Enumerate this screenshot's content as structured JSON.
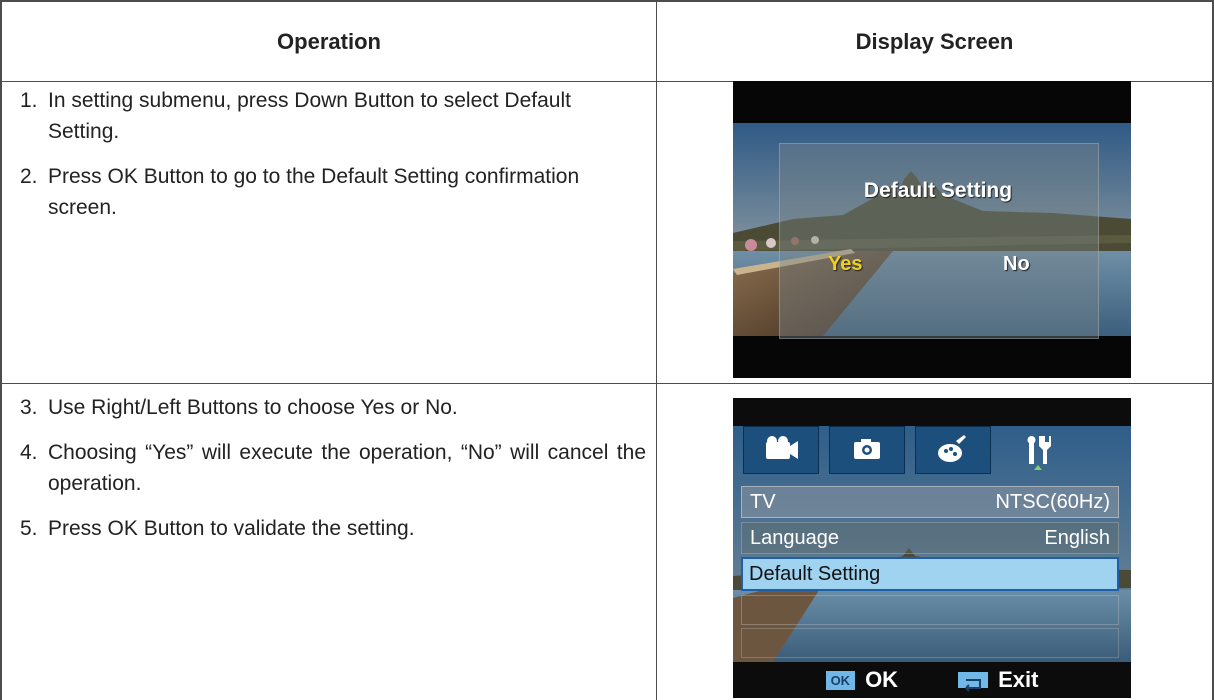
{
  "table": {
    "header_operation": "Operation",
    "header_display": "Display Screen"
  },
  "row1": {
    "steps": [
      {
        "num": "1.",
        "text": "In setting submenu, press Down Button to select Default Setting."
      },
      {
        "num": "2.",
        "text": "Press OK Button to go to the Default Setting confirmation screen."
      }
    ],
    "screen": {
      "dialog_title": "Default Setting",
      "yes_label": "Yes",
      "no_label": "No",
      "yes_color": "#f0d21e",
      "no_color": "#ffffff"
    }
  },
  "row2": {
    "steps": [
      {
        "num": "3.",
        "text": "Use Right/Left Buttons to choose Yes or No."
      },
      {
        "num": "4.",
        "text": "Choosing “Yes” will execute the operation, “No” will cancel the operation."
      },
      {
        "num": "5.",
        "text": "Press OK Button to validate the setting."
      }
    ],
    "screen": {
      "tabs": [
        {
          "icon": "video-camera-icon"
        },
        {
          "icon": "photo-camera-icon"
        },
        {
          "icon": "effects-palette-icon"
        },
        {
          "icon": "setup-tools-icon",
          "selected": true
        }
      ],
      "menu": [
        {
          "label": "TV",
          "value": "NTSC(60Hz)"
        },
        {
          "label": "Language",
          "value": "English"
        },
        {
          "label": "Default Setting",
          "value": "",
          "highlighted": true
        }
      ],
      "ok_badge": "OK",
      "ok_label": "OK",
      "exit_label": "Exit",
      "highlight_color": "#9fd3f0"
    }
  }
}
